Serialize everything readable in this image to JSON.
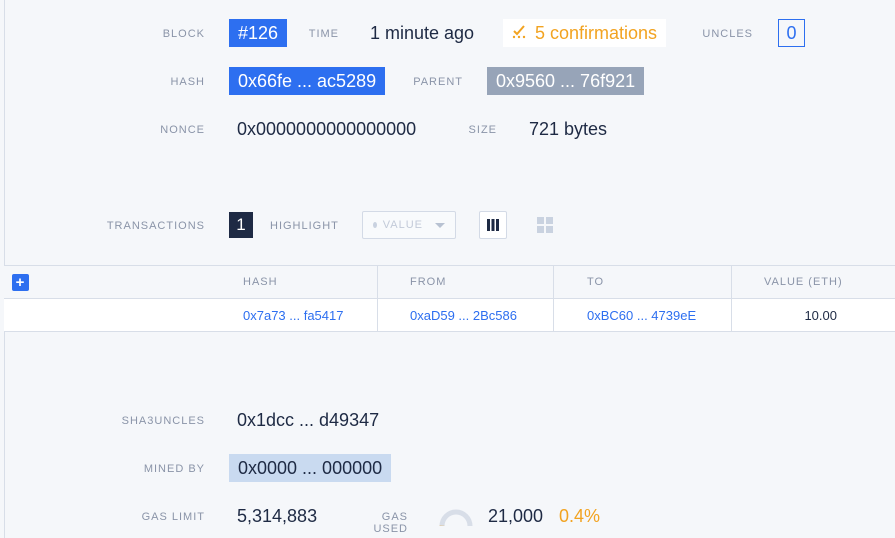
{
  "block": {
    "label": "BLOCK",
    "value": "#126"
  },
  "time": {
    "label": "TIME",
    "value": "1 minute ago"
  },
  "confirmations": {
    "value": "5 confirmations",
    "icon": "check-progress-icon"
  },
  "uncles": {
    "label": "UNCLES",
    "value": "0"
  },
  "hash": {
    "label": "HASH",
    "value": "0x66fe ... ac5289"
  },
  "parent": {
    "label": "PARENT",
    "value": "0x9560 ... 76f921"
  },
  "nonce": {
    "label": "NONCE",
    "value": "0x0000000000000000"
  },
  "size": {
    "label": "SIZE",
    "value": "721 bytes"
  },
  "transactions": {
    "label": "TRANSACTIONS",
    "count": "1",
    "highlight_label": "HIGHLIGHT",
    "highlight_select": "VALUE",
    "columns": [
      "HASH",
      "FROM",
      "TO",
      "VALUE (ETH)"
    ],
    "rows": [
      {
        "hash": "0x7a73 ... fa5417",
        "from": "0xaD59 ... 2Bc586",
        "to": "0xBC60 ... 4739eE",
        "value": "10.00"
      }
    ]
  },
  "sha3uncles": {
    "label": "SHA3UNCLES",
    "value": "0x1dcc ... d49347"
  },
  "mined_by": {
    "label": "MINED BY",
    "value": "0x0000 ... 000000"
  },
  "gas_limit": {
    "label": "GAS LIMIT",
    "value": "5,314,883"
  },
  "gas_used": {
    "label": "GAS USED",
    "value": "21,000",
    "percent": "0.4%",
    "fraction": 0.004
  },
  "colors": {
    "accent": "#2d6ff0",
    "warning": "#f2a321",
    "dark": "#1e2a44",
    "muted": "#97a4b8"
  }
}
